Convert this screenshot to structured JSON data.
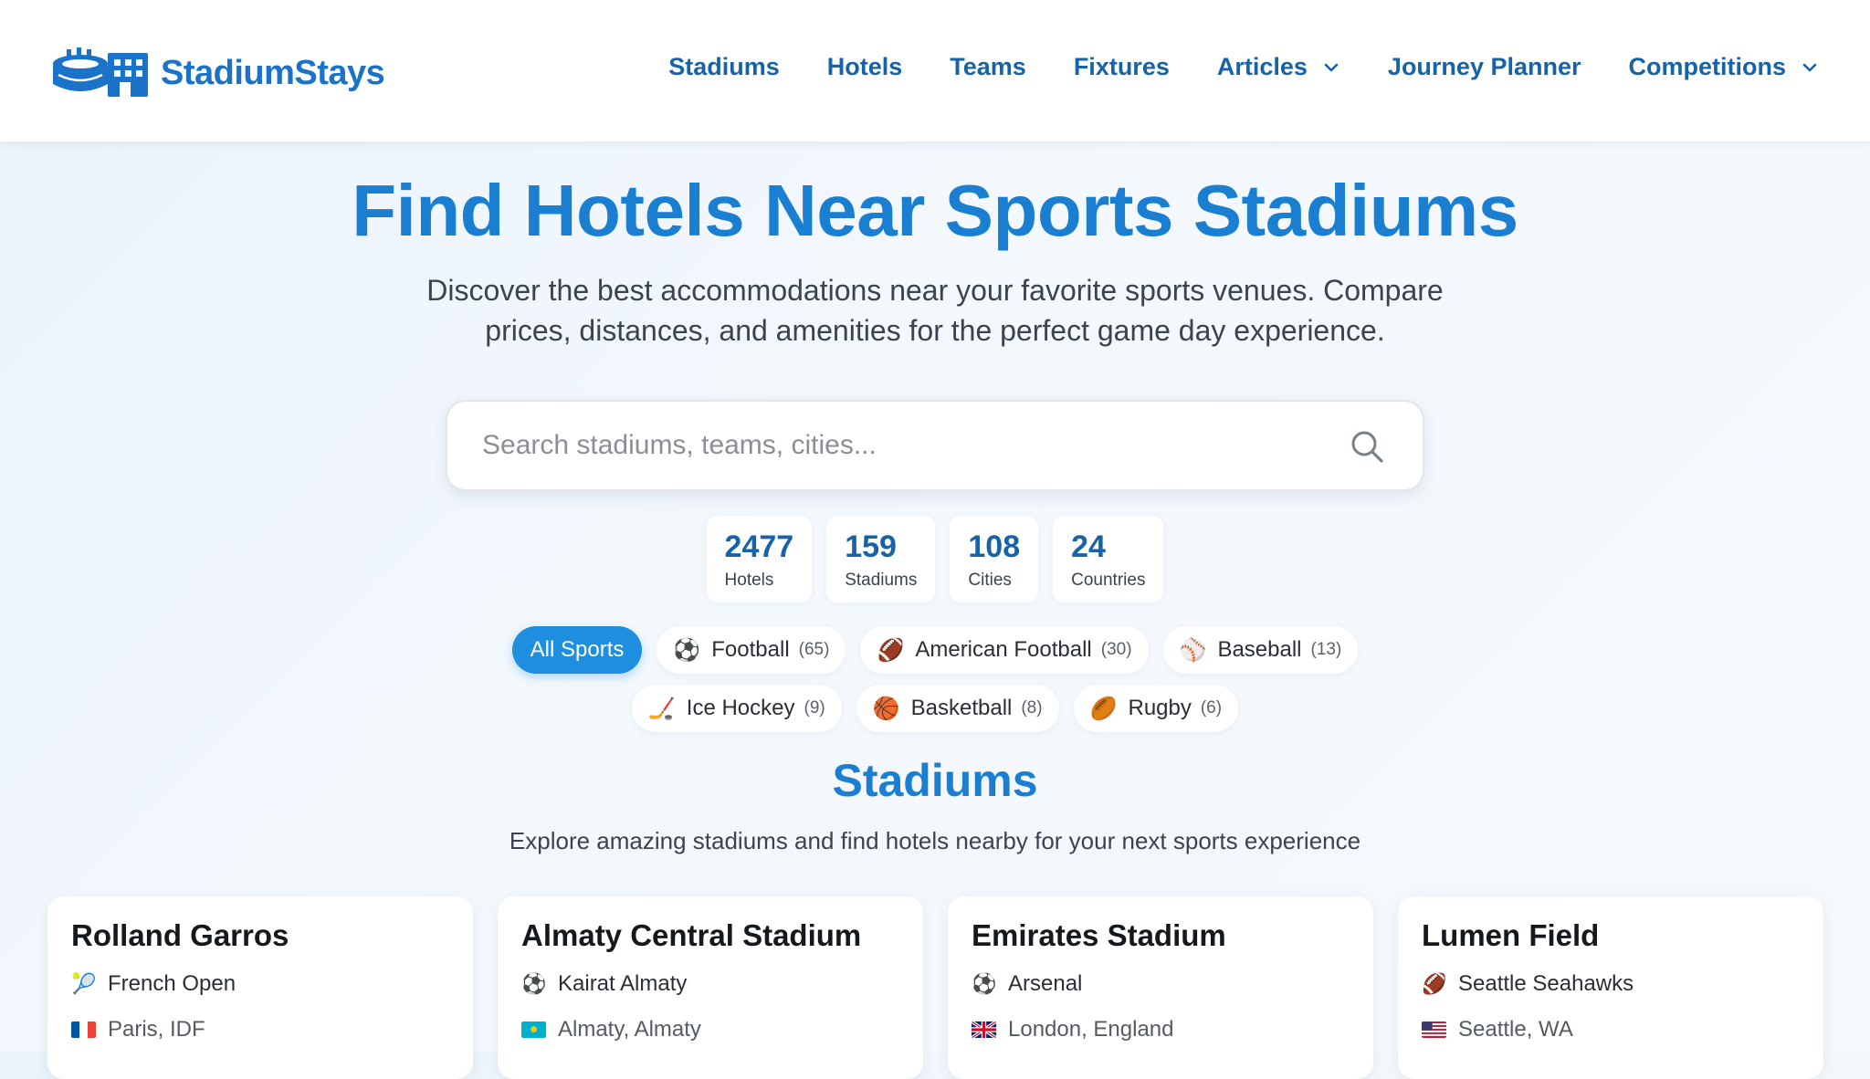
{
  "brand": {
    "name": "StadiumStays"
  },
  "nav": {
    "items": [
      {
        "label": "Stadiums",
        "has_dropdown": false
      },
      {
        "label": "Hotels",
        "has_dropdown": false
      },
      {
        "label": "Teams",
        "has_dropdown": false
      },
      {
        "label": "Fixtures",
        "has_dropdown": false
      },
      {
        "label": "Articles",
        "has_dropdown": true
      },
      {
        "label": "Journey Planner",
        "has_dropdown": false
      },
      {
        "label": "Competitions",
        "has_dropdown": true
      }
    ]
  },
  "hero": {
    "title": "Find Hotels Near Sports Stadiums",
    "subtitle": "Discover the best accommodations near your favorite sports venues. Compare prices, distances, and amenities for the perfect game day experience."
  },
  "search": {
    "placeholder": "Search stadiums, teams, cities..."
  },
  "stats": [
    {
      "value": "2477",
      "label": "Hotels"
    },
    {
      "value": "159",
      "label": "Stadiums"
    },
    {
      "value": "108",
      "label": "Cities"
    },
    {
      "value": "24",
      "label": "Countries"
    }
  ],
  "filters": {
    "all_label": "All Sports",
    "sports": [
      {
        "icon": "⚽",
        "label": "Football",
        "count": "(65)"
      },
      {
        "icon": "🏈",
        "label": "American Football",
        "count": "(30)"
      },
      {
        "icon": "⚾",
        "label": "Baseball",
        "count": "(13)"
      },
      {
        "icon": "🏒",
        "label": "Ice Hockey",
        "count": "(9)"
      },
      {
        "icon": "🏀",
        "label": "Basketball",
        "count": "(8)"
      },
      {
        "icon": "🏉",
        "label": "Rugby",
        "count": "(6)"
      }
    ]
  },
  "stadiums_section": {
    "title": "Stadiums",
    "subtitle": "Explore amazing stadiums and find hotels nearby for your next sports experience"
  },
  "stadium_cards": [
    {
      "name": "Rolland Garros",
      "sport_icon": "🎾",
      "team": "French Open",
      "flag": "fr",
      "location": "Paris, IDF"
    },
    {
      "name": "Almaty Central Stadium",
      "sport_icon": "⚽",
      "team": "Kairat Almaty",
      "flag": "kz",
      "location": "Almaty, Almaty"
    },
    {
      "name": "Emirates Stadium",
      "sport_icon": "⚽",
      "team": "Arsenal",
      "flag": "gb",
      "location": "London, England"
    },
    {
      "name": "Lumen Field",
      "sport_icon": "🏈",
      "team": "Seattle Seahawks",
      "flag": "us",
      "location": "Seattle, WA"
    }
  ],
  "colors": {
    "brand_blue": "#1a73c9",
    "nav_blue": "#1663a8",
    "title_blue": "#1a7fd0",
    "active_chip": "#1e8ee0"
  }
}
